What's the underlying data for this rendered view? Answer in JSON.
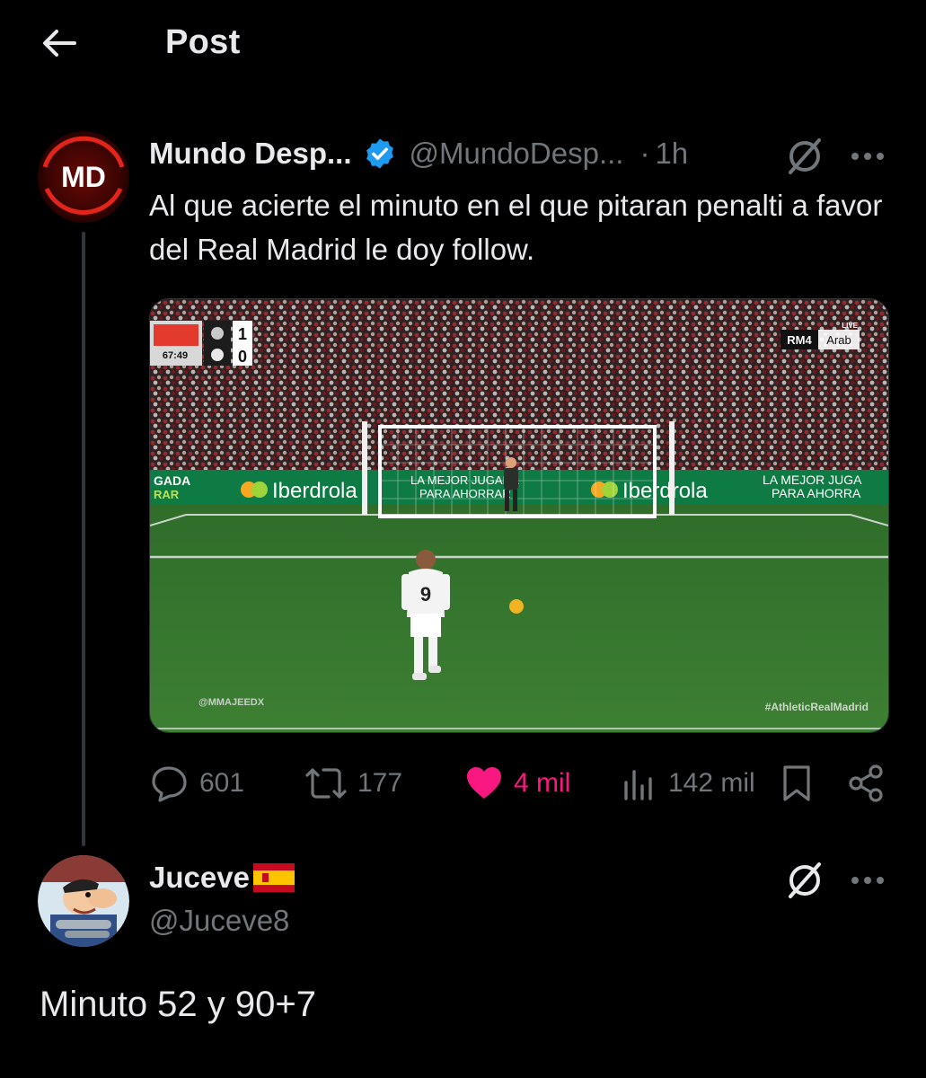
{
  "header": {
    "title": "Post",
    "back_icon": "arrow-left-icon"
  },
  "tweet": {
    "author_name": "Mundo Desp...",
    "handle": "@MundoDesp...",
    "separator": "·",
    "time": "1h",
    "avatar_text": "MD",
    "text": "Al que acierte el minuto en el que pitaran penalti a favor del Real Madrid le doy follow.",
    "media": {
      "scoreboard_time": "67:49",
      "score_home": "1",
      "score_away": "0",
      "channel_tag": "RM4",
      "channel_lang": "Arab",
      "channel_live": "LIVE",
      "watermark": "@MMAJEEDX",
      "hashtag": "#AthleticRealMadrid",
      "board_left_1": "GADA",
      "board_left_2": "RAR",
      "board_brand_1": "Iberdrola",
      "board_slogan_1": "LA MEJOR JUGADA",
      "board_slogan_2": "PARA AHORRAR",
      "board_brand_2": "Iberdrola",
      "board_right_1": "LA MEJOR JUGA",
      "board_right_2": "PARA AHORRA",
      "shirt_number": "9"
    },
    "stats": {
      "replies": "601",
      "reposts": "177",
      "likes": "4 mil",
      "views": "142 mil"
    },
    "colors": {
      "like": "#f91880",
      "verified": "#1d9bf0",
      "muted": "#71767b"
    }
  },
  "reply": {
    "name": "Juceve",
    "handle": "@Juceve8",
    "text": "Minuto 52 y 90+7"
  }
}
